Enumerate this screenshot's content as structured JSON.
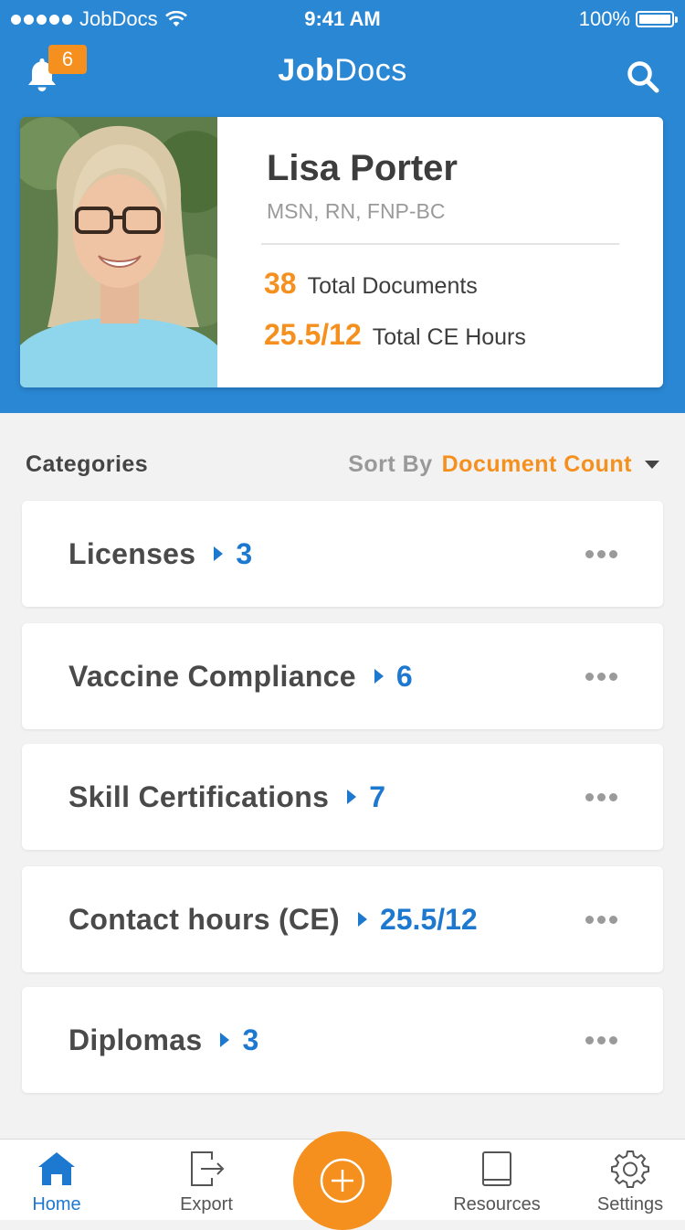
{
  "status_bar": {
    "carrier": "JobDocs",
    "time": "9:41 AM",
    "battery": "100%",
    "signal_icon": "signal-dots-icon",
    "wifi_icon": "wifi-icon",
    "battery_icon": "battery-icon"
  },
  "nav": {
    "title_bold": "Job",
    "title_light": "Docs",
    "notification_count": "6",
    "bell_icon": "bell-icon",
    "search_icon": "search-icon"
  },
  "profile": {
    "name": "Lisa Porter",
    "credentials": "MSN, RN, FNP-BC",
    "documents_count": "38",
    "documents_label": "Total Documents",
    "ce_hours": "25.5/12",
    "ce_label": "Total CE Hours"
  },
  "categories": {
    "heading": "Categories",
    "sort_label": "Sort By",
    "sort_value": "Document Count",
    "items": [
      {
        "label": "Licenses",
        "count": "3"
      },
      {
        "label": "Vaccine Compliance",
        "count": "6"
      },
      {
        "label": "Skill Certifications",
        "count": "7"
      },
      {
        "label": "Contact hours (CE)",
        "count": "25.5/12"
      },
      {
        "label": "Diplomas",
        "count": "3"
      }
    ]
  },
  "tabbar": {
    "tabs": [
      {
        "label": "Home",
        "icon": "home-icon",
        "active": true
      },
      {
        "label": "Export",
        "icon": "export-icon",
        "active": false
      },
      {
        "label": "Resources",
        "icon": "book-icon",
        "active": false
      },
      {
        "label": "Settings",
        "icon": "gear-icon",
        "active": false
      }
    ],
    "fab_icon": "plus-circle-icon"
  },
  "colors": {
    "header_blue": "#2a87d4",
    "accent_orange": "#f5901e",
    "link_blue": "#1d79cf",
    "background": "#f2f2f2"
  }
}
